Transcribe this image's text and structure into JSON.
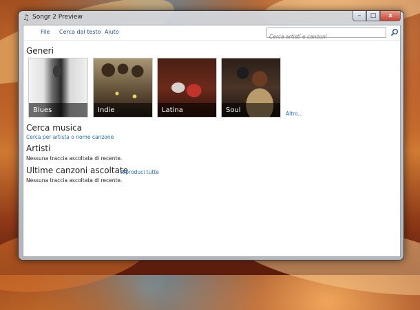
{
  "window": {
    "title": "Songr 2 Preview",
    "controls": {
      "minimize": "–",
      "maximize": "□",
      "close": "x"
    }
  },
  "menu": {
    "items": [
      "File",
      "Cerca dal testo",
      "Aiuto"
    ]
  },
  "search": {
    "placeholder": "Cerca artisti e canzoni"
  },
  "genres": {
    "heading": "Generi",
    "items": [
      "Blues",
      "Indie",
      "Latina",
      "Soul"
    ],
    "more_link": "Altro..."
  },
  "search_music": {
    "heading": "Cerca musica",
    "link": "Cerca per artista o nome canzone"
  },
  "artists": {
    "heading": "Artisti",
    "empty_text": "Nessuna traccia ascoltata di recente."
  },
  "recent_songs": {
    "heading": "Ultime canzoni ascoltate",
    "play_all_link": "Riproduci tutte",
    "empty_text": "Nessuna traccia ascoltata di recente."
  },
  "colors": {
    "link": "#1d6fc6",
    "menu_text": "#1d4f91",
    "close_button": "#c64530"
  }
}
